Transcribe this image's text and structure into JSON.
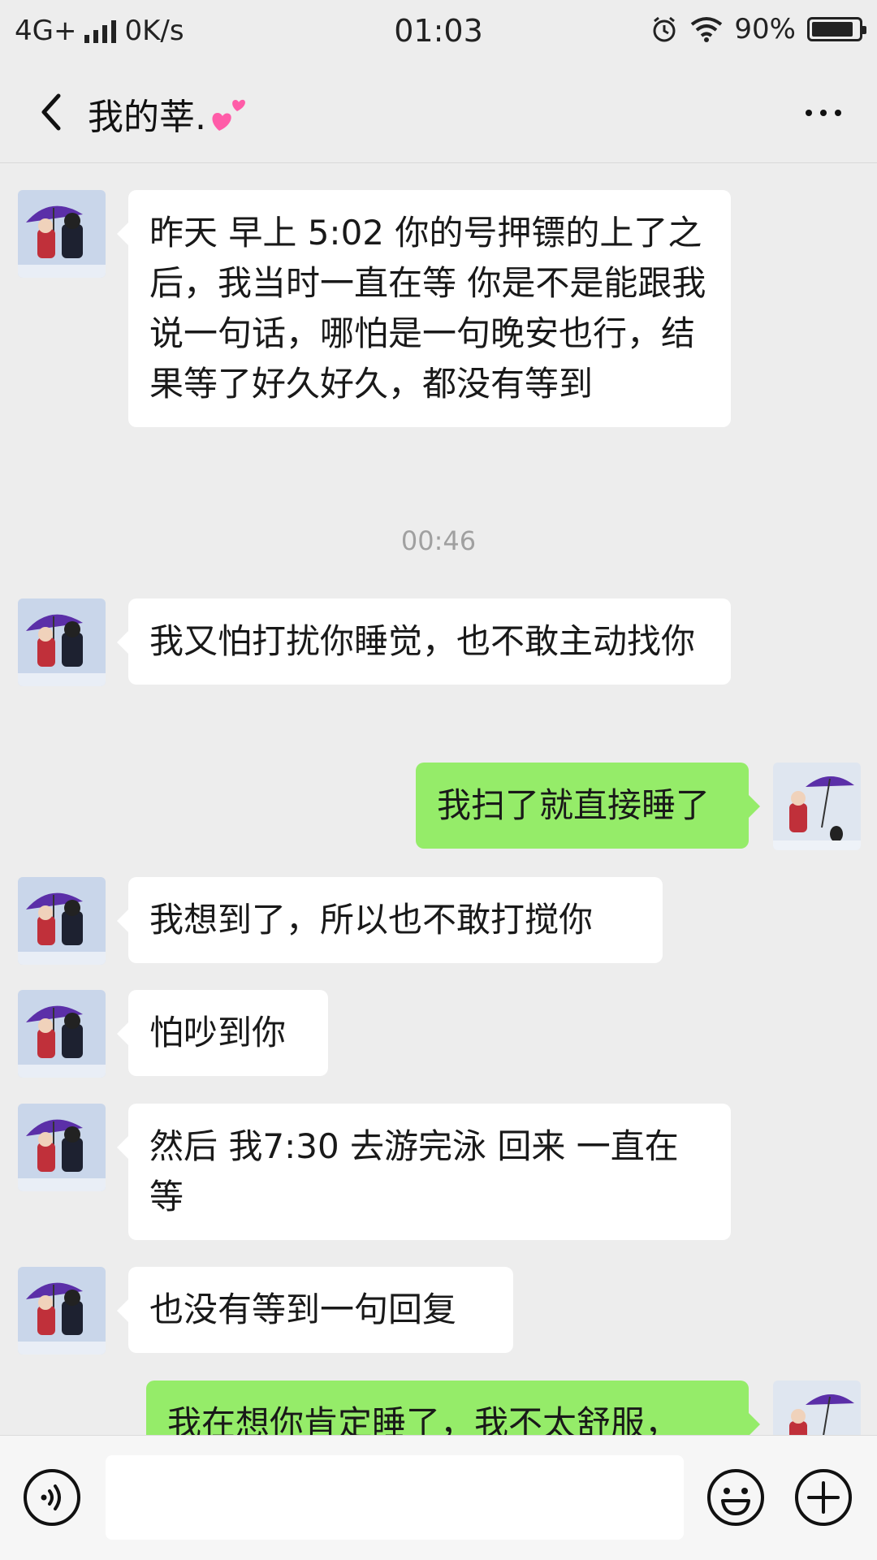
{
  "status_bar": {
    "network": "4G+",
    "speed": "0K/s",
    "time": "01:03",
    "battery": "90%",
    "battery_level": 0.9
  },
  "header": {
    "title": "我的莘.",
    "title_icon": "two-hearts-emoji",
    "back_icon": "chevron-left-icon",
    "more_icon": "more-dots-icon"
  },
  "messages": [
    {
      "side": "left",
      "text": "昨天 早上 5:02 你的号押镖的上了之后，我当时一直在等 你是不是能跟我说一句话，哪怕是一句晚安也行，结果等了好久好久，都没有等到"
    },
    {
      "type": "time",
      "text": "00:46"
    },
    {
      "side": "left",
      "text": "我又怕打扰你睡觉，也不敢主动找你"
    },
    {
      "side": "right",
      "text": "我扫了就直接睡了"
    },
    {
      "side": "left",
      "text": "我想到了，所以也不敢打搅你"
    },
    {
      "side": "left",
      "text": "怕吵到你"
    },
    {
      "side": "left",
      "text": "然后 我7:30 去游完泳 回来 一直在等"
    },
    {
      "side": "left",
      "text": "也没有等到一句回复"
    },
    {
      "side": "right",
      "text": "我在想你肯定睡了，我不太舒服，"
    }
  ],
  "input_bar": {
    "voice_icon": "voice-icon",
    "input_value": "",
    "emoji_icon": "emoji-icon",
    "plus_icon": "plus-icon"
  },
  "colors": {
    "background": "#ededed",
    "bubble_left": "#ffffff",
    "bubble_right": "#95ec69",
    "timestamp": "#a0a0a0"
  }
}
